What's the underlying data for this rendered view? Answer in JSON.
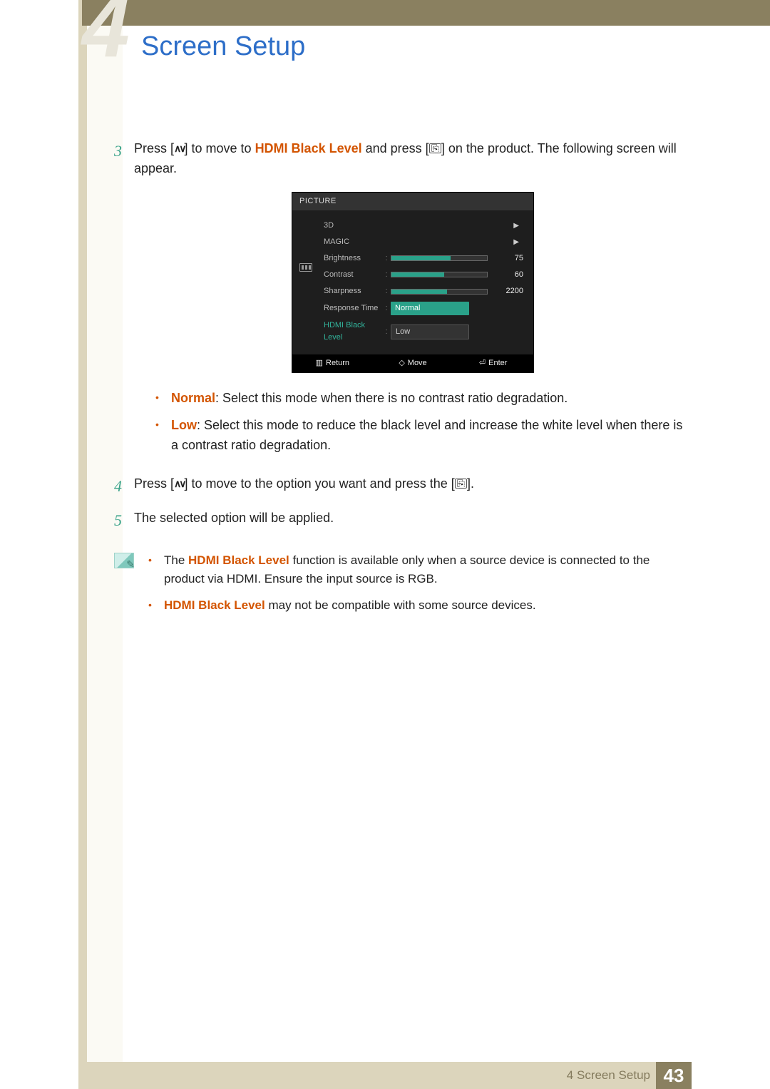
{
  "page": {
    "chapter_hint_number": "4",
    "title": "Screen Setup"
  },
  "steps": {
    "s3": {
      "num": "3",
      "t1": "Press [",
      "t2": "] to move to ",
      "keyword": "HDMI Black Level",
      "t3": " and press [",
      "t4": "] on the product. The following screen will appear."
    },
    "s4": {
      "num": "4",
      "t1": "Press [",
      "t2": "] to move to the option you want and press the [",
      "t3": "]."
    },
    "s5": {
      "num": "5",
      "text": "The selected option will be applied."
    }
  },
  "mode_bullets": {
    "normal": {
      "label": "Normal",
      "text": ": Select this mode when there is no contrast ratio degradation."
    },
    "low": {
      "label": "Low",
      "text": ": Select this mode to reduce the black level and increase the white level when there is a contrast ratio degradation."
    }
  },
  "osd": {
    "header": "PICTURE",
    "rows": {
      "r3d": {
        "label": "3D"
      },
      "magic": {
        "label": "MAGIC"
      },
      "brightness": {
        "label": "Brightness",
        "value": "75",
        "fill": 62
      },
      "contrast": {
        "label": "Contrast",
        "value": "60",
        "fill": 55
      },
      "sharpness": {
        "label": "Sharpness",
        "value": "2200",
        "fill": 58
      },
      "response": {
        "label": "Response Time",
        "value": "Normal"
      },
      "hdmiblk": {
        "label": "HDMI Black Level",
        "value": "Low"
      }
    },
    "footer": {
      "return": "Return",
      "move": "Move",
      "enter": "Enter"
    }
  },
  "notes": {
    "n1": {
      "pre": "The ",
      "keyword": "HDMI Black Level",
      "text": " function is available only when a source device is connected to the product via HDMI. Ensure the input source is RGB."
    },
    "n2": {
      "keyword": "HDMI Black Level",
      "text": " may not be compatible with some source devices."
    }
  },
  "footer": {
    "section": "4 Screen Setup",
    "page_number": "43"
  }
}
